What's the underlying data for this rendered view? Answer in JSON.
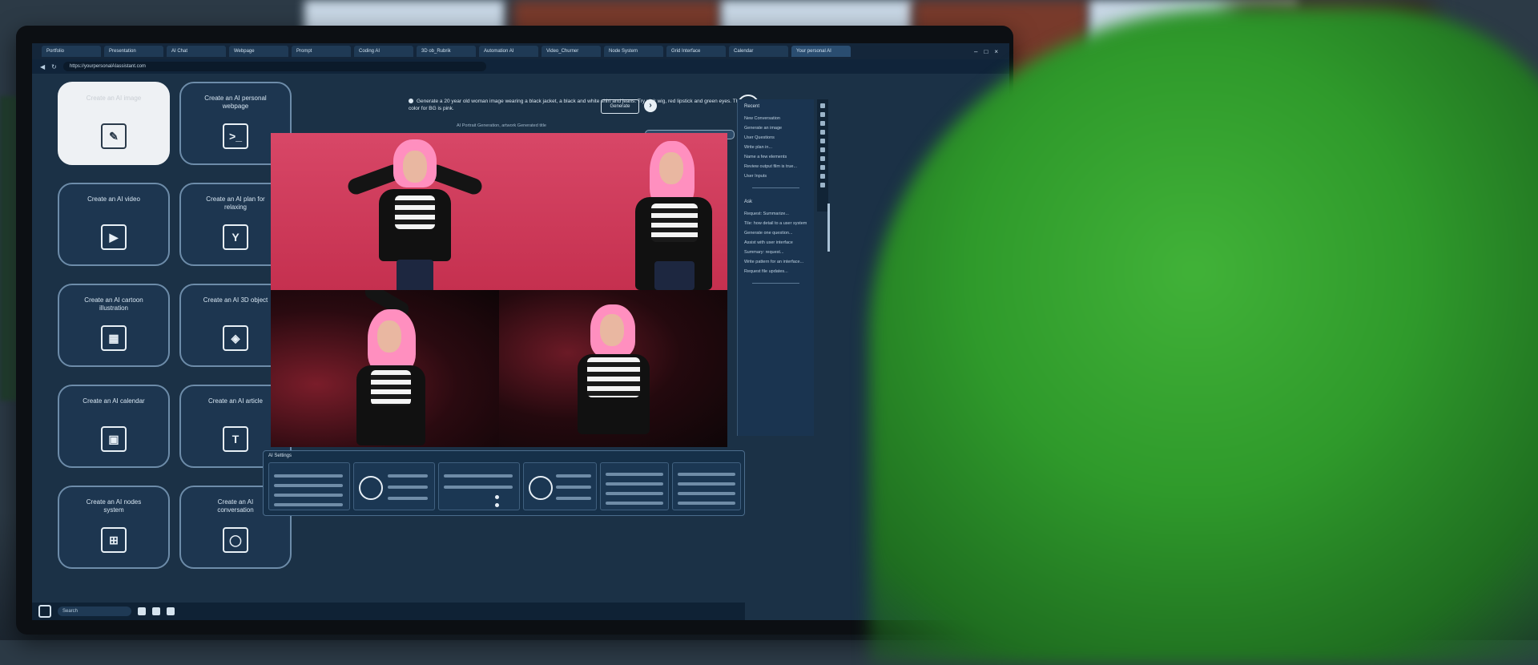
{
  "browser": {
    "tabs": [
      "Portfolio",
      "Presentation",
      "AI Chat",
      "Webpage",
      "Prompt",
      "Coding AI",
      "3D ob_Rubrik",
      "Automation AI",
      "Video_Churner",
      "Node System",
      "Grid Interface",
      "Calendar",
      "Your personal AI"
    ],
    "url": "https://yourpersonalAIassistant.com"
  },
  "tiles": [
    {
      "label": "Create an AI image",
      "icon": "palette-icon",
      "selected": true
    },
    {
      "label": "Create an AI personal webpage",
      "icon": "terminal-icon",
      "selected": false
    },
    {
      "label": "Create an AI video",
      "icon": "play-icon",
      "selected": false
    },
    {
      "label": "Create an AI plan for relaxing",
      "icon": "cocktail-icon",
      "selected": false
    },
    {
      "label": "Create an AI cartoon illustration",
      "icon": "panel-icon",
      "selected": false
    },
    {
      "label": "Create an AI 3D object",
      "icon": "cube-icon",
      "selected": false
    },
    {
      "label": "Create an AI calendar",
      "icon": "calendar-icon",
      "selected": false
    },
    {
      "label": "Create an AI article",
      "icon": "text-icon",
      "selected": false
    },
    {
      "label": "Create an AI nodes system",
      "icon": "nodes-icon",
      "selected": false
    },
    {
      "label": "Create an AI conversation",
      "icon": "chat-icon",
      "selected": false
    }
  ],
  "prompt": {
    "text": "Generate a 20 year old woman image wearing a black jacket, a black and white shirt and jeans. Try pink wig, red lipstick and green eyes. The color for BG is pink.",
    "generate_label": "Generate",
    "caption": "AI Portrait Generation, artwork Generated title"
  },
  "right_panel": {
    "head": "Recent",
    "items_top": [
      "New Conversation",
      "Generate an image",
      "User Questions",
      "Write plan in...",
      "Name a few elements",
      "Review output film is true...",
      "User Inputs"
    ],
    "section": "Ask",
    "items_bottom": [
      "Request: Summarize...",
      "Tile: how detail to a user system",
      "Generate one question...",
      "Assist with user interface",
      "Summary: request...",
      "Write pattern for an interface...",
      "Request file updates..."
    ]
  },
  "settings": {
    "title": "AI Settings"
  },
  "taskbar": {
    "search": "Search"
  }
}
